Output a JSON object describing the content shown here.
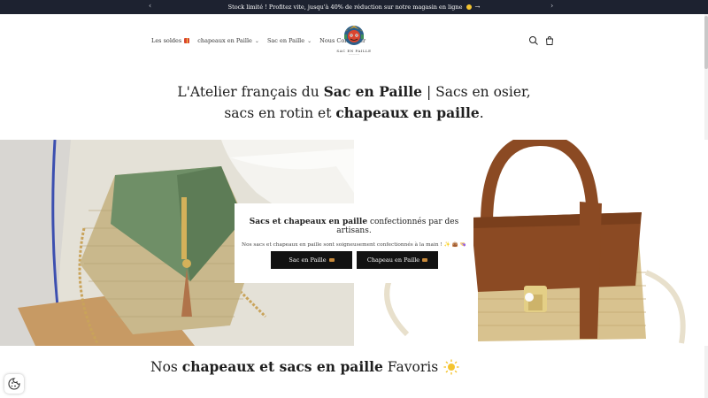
{
  "announcement": {
    "text": "Stock limité ! Profitez vite, jusqu'à 40% de réduction sur notre magasin en ligne",
    "prev_icon": "chevron-left-icon",
    "next_icon": "chevron-right-icon"
  },
  "nav": {
    "items": [
      {
        "label": "Les soldes"
      },
      {
        "label": "chapeaux en Paille"
      },
      {
        "label": "Sac en Paille"
      },
      {
        "label": "Nous Contacter"
      }
    ]
  },
  "logo": {
    "text": "SAC EN PAILLE",
    "sub": "—————"
  },
  "hero": {
    "title_part1": "L'Atelier français du ",
    "title_bold1": "Sac en Paille",
    "title_part2": " | Sacs en osier, sacs en rotin et ",
    "title_bold2": "chapeaux en paille",
    "title_part3": "."
  },
  "card": {
    "title_bold": "Sacs et chapeaux en paille",
    "title_rest": " confectionnés par des artisans.",
    "text": "Nos sacs et chapeaux en paille sont soigneusement confectionnés à la main ! ✨ 👜 👒",
    "button1": "Sac en Paille",
    "button2": "Chapeau en Paille"
  },
  "section": {
    "title_part1": "Nos ",
    "title_bold": "chapeaux et sacs en paille",
    "title_part2": " Favoris"
  },
  "colors": {
    "announcement_bg": "#1d2230",
    "button_bg": "#121212",
    "bag_green": "#6f8f67",
    "bag_brown": "#8b4a23",
    "straw": "#c9b88c"
  }
}
